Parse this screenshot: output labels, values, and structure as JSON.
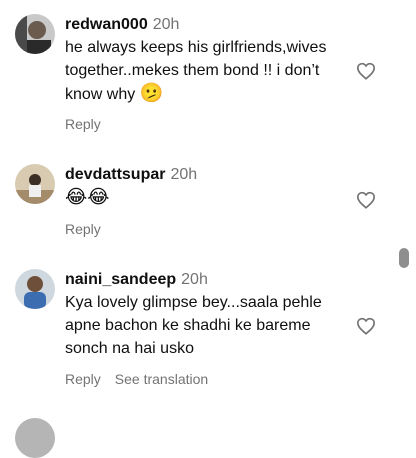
{
  "comments": [
    {
      "username": "redwan000",
      "time": "20h",
      "text": "he always keeps his girlfriends,wives together..mekes them bond !! i don’t know why",
      "emoji": "🫤",
      "reply_label": "Reply"
    },
    {
      "username": "devdattsupar",
      "time": "20h",
      "text": "",
      "emoji": "😂😂",
      "reply_label": "Reply"
    },
    {
      "username": "naini_sandeep",
      "time": "20h",
      "text": "Kya lovely glimpse bey...saala pehle apne bachon ke shadhi ke bareme sonch na hai usko",
      "emoji": "",
      "reply_label": "Reply",
      "translate_label": "See translation"
    }
  ],
  "colors": {
    "muted": "#737373",
    "heart_stroke": "#737373"
  },
  "icons": [
    "heart-icon",
    "avatar"
  ]
}
